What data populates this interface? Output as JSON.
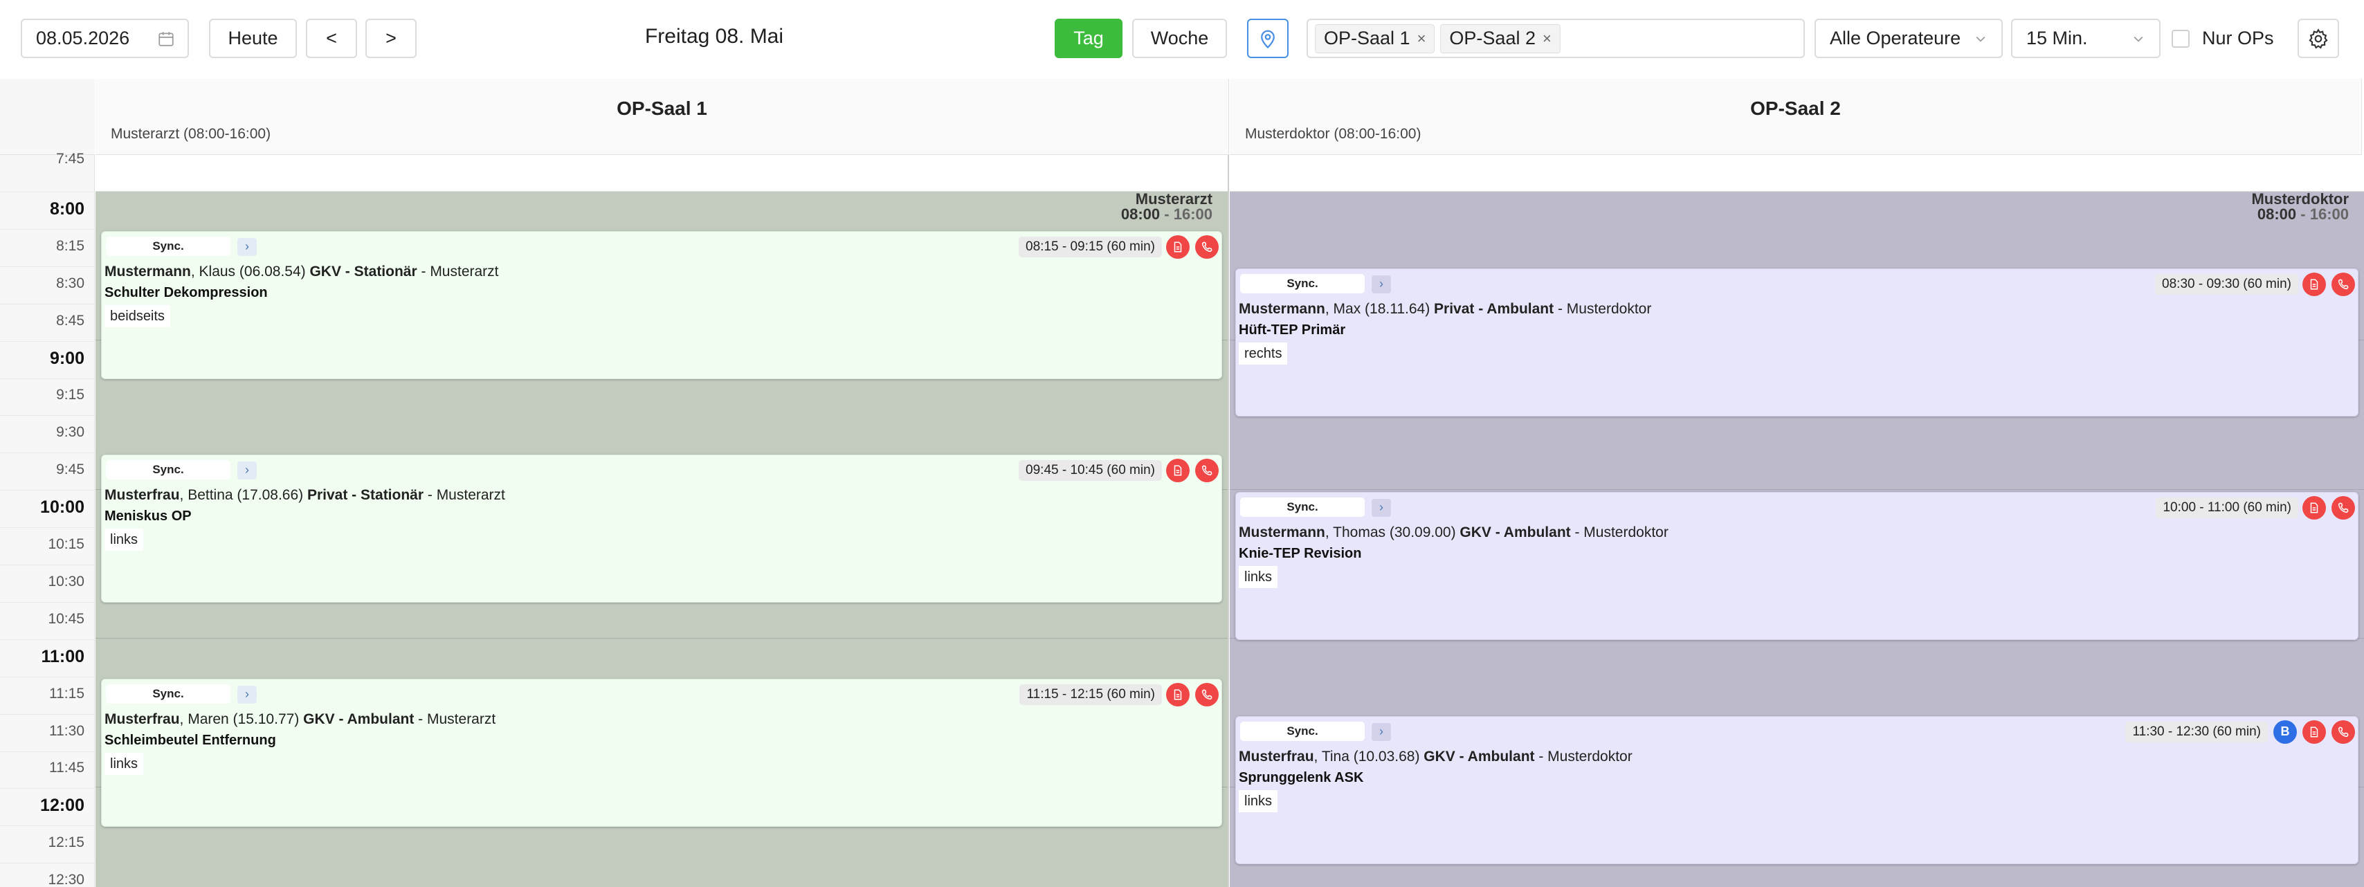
{
  "toolbar": {
    "date_value": "08.05.2026",
    "today_label": "Heute",
    "prev_label": "<",
    "next_label": ">",
    "title": "Freitag 08. Mai",
    "day_label": "Tag",
    "week_label": "Woche",
    "rooms": [
      "OP-Saal 1",
      "OP-Saal 2"
    ],
    "remove_glyph": "×",
    "operators_label": "Alle Operateure",
    "interval_label": "15 Min.",
    "only_ops_label": "Nur OPs",
    "accent_green": "#3cbb3c",
    "accent_blue": "#4a8fe6"
  },
  "time_labels": [
    "7:45",
    "8:00",
    "8:15",
    "8:30",
    "8:45",
    "9:00",
    "9:15",
    "9:30",
    "9:45",
    "10:00",
    "10:15",
    "10:30",
    "10:45",
    "11:00",
    "11:15",
    "11:30",
    "11:45",
    "12:00",
    "12:15",
    "12:30"
  ],
  "columns": [
    {
      "name": "OP-Saal 1",
      "doctor_hours": "Musterarzt (08:00-16:00)",
      "shift_name": "Musterarzt",
      "shift_start": "08:00",
      "shift_sep": " - ",
      "shift_end": "16:00",
      "events": [
        {
          "sync": "Sync.",
          "arrow": "›",
          "time": "08:15 - 09:15 (60 min)",
          "lastname": "Mustermann",
          "rest": ", Klaus (06.08.54) ",
          "insurance": "GKV - Stationär",
          "doctor": " - Musterarzt",
          "procedure": "Schulter Dekompression",
          "side": "beidseits",
          "badge_b": ""
        },
        {
          "sync": "Sync.",
          "arrow": "›",
          "time": "09:45 - 10:45 (60 min)",
          "lastname": "Musterfrau",
          "rest": ", Bettina (17.08.66) ",
          "insurance": "Privat - Stationär",
          "doctor": " - Musterarzt",
          "procedure": "Meniskus OP",
          "side": "links",
          "badge_b": ""
        },
        {
          "sync": "Sync.",
          "arrow": "›",
          "time": "11:15 - 12:15 (60 min)",
          "lastname": "Musterfrau",
          "rest": ", Maren (15.10.77) ",
          "insurance": "GKV - Ambulant",
          "doctor": " - Musterarzt",
          "procedure": "Schleimbeutel Entfernung",
          "side": "links",
          "badge_b": ""
        }
      ]
    },
    {
      "name": "OP-Saal 2",
      "doctor_hours": "Musterdoktor (08:00-16:00)",
      "shift_name": "Musterdoktor",
      "shift_start": "08:00",
      "shift_sep": " - ",
      "shift_end": "16:00",
      "events": [
        {
          "sync": "Sync.",
          "arrow": "›",
          "time": "08:30 - 09:30 (60 min)",
          "lastname": "Mustermann",
          "rest": ", Max (18.11.64) ",
          "insurance": "Privat - Ambulant",
          "doctor": " - Musterdoktor",
          "procedure": "Hüft-TEP Primär",
          "side": "rechts",
          "badge_b": ""
        },
        {
          "sync": "Sync.",
          "arrow": "›",
          "time": "10:00 - 11:00 (60 min)",
          "lastname": "Mustermann",
          "rest": ", Thomas (30.09.00) ",
          "insurance": "GKV - Ambulant",
          "doctor": " - Musterdoktor",
          "procedure": "Knie-TEP Revision",
          "side": "links",
          "badge_b": ""
        },
        {
          "sync": "Sync.",
          "arrow": "›",
          "time": "11:30 - 12:30 (60 min)",
          "lastname": "Musterfrau",
          "rest": ", Tina (10.03.68) ",
          "insurance": "GKV - Ambulant",
          "doctor": " - Musterdoktor",
          "procedure": "Sprunggelenk ASK",
          "side": "links",
          "badge_b": "B"
        }
      ]
    }
  ]
}
